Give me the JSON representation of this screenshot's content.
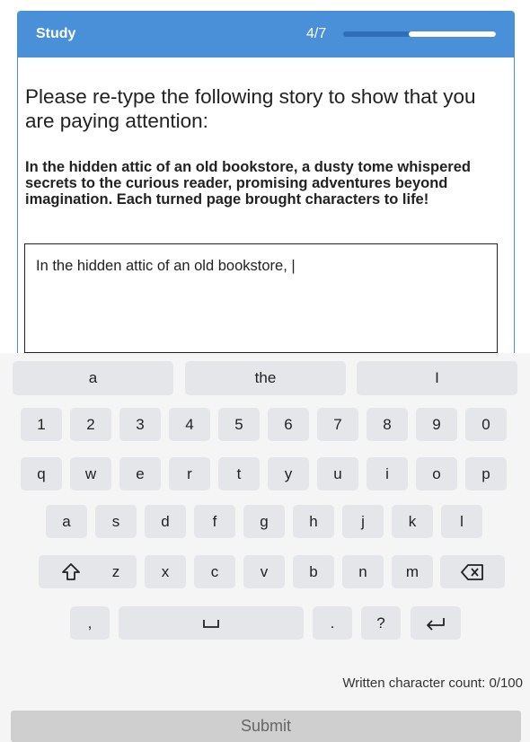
{
  "header": {
    "title": "Study",
    "progress_text": "4/7",
    "progress_fraction": 0.43,
    "accent_color": "#4a90d9"
  },
  "prompt": "Please re-type the following story to show that you are paying attention:",
  "story": "In the hidden attic of an old bookstore, a dusty tome whispered secrets to the curious reader, promising adventures beyond imagination. Each turned page brought characters to life!",
  "typed_text": "In the hidden attic of an old bookstore, |",
  "keyboard": {
    "suggestions": [
      "a",
      "the",
      "I"
    ],
    "numbers": [
      "1",
      "2",
      "3",
      "4",
      "5",
      "6",
      "7",
      "8",
      "9",
      "0"
    ],
    "row1": [
      "q",
      "w",
      "e",
      "r",
      "t",
      "y",
      "u",
      "i",
      "o",
      "p"
    ],
    "row2": [
      "a",
      "s",
      "d",
      "f",
      "g",
      "h",
      "j",
      "k",
      "l"
    ],
    "row3": [
      "z",
      "x",
      "c",
      "v",
      "b",
      "n",
      "m"
    ],
    "comma": ",",
    "period": ".",
    "question": "?",
    "shift_icon": "shift-icon",
    "backspace_icon": "backspace-icon",
    "space_icon": "space-icon",
    "enter_icon": "enter-icon"
  },
  "char_count": "Written character count: 0/100",
  "submit_label": "Submit"
}
